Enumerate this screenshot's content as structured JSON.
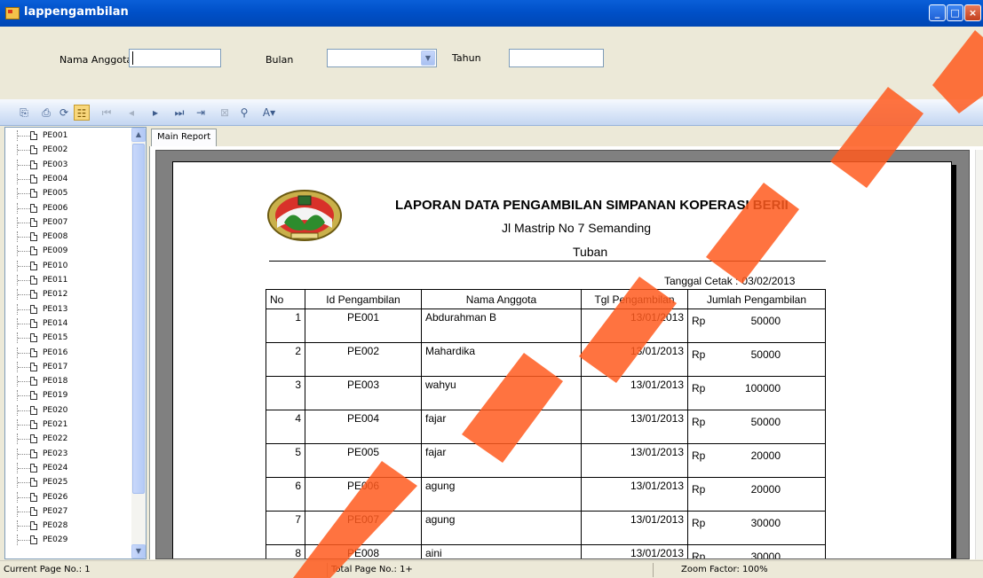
{
  "window": {
    "title": "lappengambilan"
  },
  "filters": {
    "nama_anggota_label": "Nama Anggota",
    "nama_anggota_value": "",
    "bulan_label": "Bulan",
    "bulan_value": "",
    "tahun_label": "Tahun",
    "tahun_value": ""
  },
  "toolbar": {
    "icons": [
      "export-icon",
      "print-icon",
      "refresh-icon",
      "toggle-tree-icon",
      "first-page-icon",
      "prev-page-icon",
      "next-page-icon",
      "last-page-icon",
      "goto-page-icon",
      "stop-icon",
      "search-icon",
      "zoom-icon"
    ]
  },
  "tree": {
    "items": [
      "PE001",
      "PE002",
      "PE003",
      "PE004",
      "PE005",
      "PE006",
      "PE007",
      "PE008",
      "PE009",
      "PE010",
      "PE011",
      "PE012",
      "PE013",
      "PE014",
      "PE015",
      "PE016",
      "PE017",
      "PE018",
      "PE019",
      "PE020",
      "PE021",
      "PE022",
      "PE023",
      "PE024",
      "PE025",
      "PE026",
      "PE027",
      "PE028",
      "PE029"
    ]
  },
  "tabs": {
    "main_report": "Main Report"
  },
  "report": {
    "title": "LAPORAN DATA PENGAMBILAN SIMPANAN KOPERASI BERII",
    "address": "Jl Mastrip No 7 Semanding",
    "city": "Tuban",
    "tanggal_cetak_label": "Tanggal Cetak  :",
    "tanggal_cetak_value": "03/02/2013",
    "columns": [
      "No",
      "Id Pengambilan",
      "Nama Anggota",
      "Tgl Pengambilan",
      "Jumlah Pengambilan"
    ],
    "currency": "Rp",
    "rows": [
      {
        "no": "1",
        "id": "PE001",
        "nama": "Abdurahman B",
        "tgl": "13/01/2013",
        "jumlah": "50000"
      },
      {
        "no": "2",
        "id": "PE002",
        "nama": "Mahardika",
        "tgl": "13/01/2013",
        "jumlah": "50000"
      },
      {
        "no": "3",
        "id": "PE003",
        "nama": "wahyu",
        "tgl": "13/01/2013",
        "jumlah": "100000"
      },
      {
        "no": "4",
        "id": "PE004",
        "nama": "fajar",
        "tgl": "13/01/2013",
        "jumlah": "50000"
      },
      {
        "no": "5",
        "id": "PE005",
        "nama": "fajar",
        "tgl": "13/01/2013",
        "jumlah": "20000"
      },
      {
        "no": "6",
        "id": "PE006",
        "nama": "agung",
        "tgl": "13/01/2013",
        "jumlah": "20000"
      },
      {
        "no": "7",
        "id": "PE007",
        "nama": "agung",
        "tgl": "13/01/2013",
        "jumlah": "30000"
      },
      {
        "no": "8",
        "id": "PE008",
        "nama": "aini",
        "tgl": "13/01/2013",
        "jumlah": "30000"
      }
    ]
  },
  "status": {
    "current_page": "Current Page No.: 1",
    "total_page": "Total Page No.: 1+",
    "zoom": "Zoom Factor: 100%"
  },
  "colors": {
    "titlebar": "#0050c8",
    "watermark": "#ff5a1e"
  }
}
